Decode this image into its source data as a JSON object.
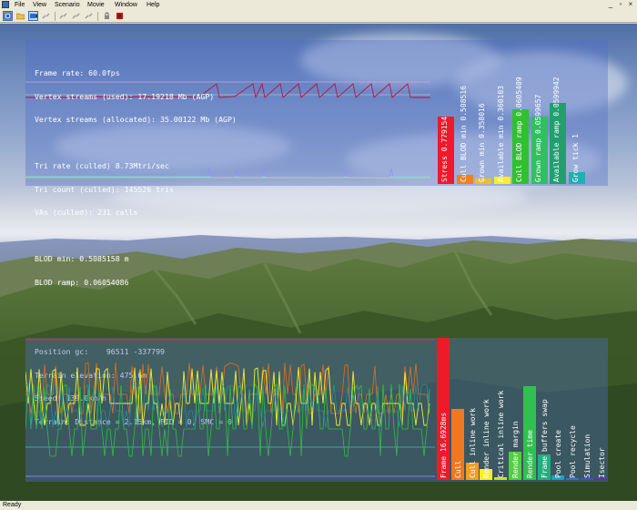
{
  "menubar": {
    "items": [
      "File",
      "View",
      "Scenario",
      "Movie",
      "Window",
      "Help"
    ],
    "window_controls": [
      "_",
      "▫",
      "×"
    ]
  },
  "toolbar": {
    "buttons": [
      {
        "icon": "view-icon",
        "active": true
      },
      {
        "icon": "open-icon",
        "active": false
      },
      {
        "icon": "camera-icon",
        "active": true
      },
      {
        "icon": "link-icon",
        "active": false
      },
      {
        "icon": "link-icon",
        "active": false
      },
      {
        "icon": "link-icon",
        "active": false
      },
      {
        "icon": "link-icon",
        "active": false
      },
      {
        "icon": "lock-icon",
        "active": false
      },
      {
        "icon": "record-icon",
        "active": false
      }
    ]
  },
  "stats": {
    "frame_rate": "Frame rate: 60.0fps",
    "vertex_used": "Vertex streams (used): 17.19218 Mb (AGP)",
    "vertex_alloc": "Vertex streams (allocated): 35.00122 Mb (AGP)",
    "tri_rate": "Tri rate (culled) 8.73Mtri/sec",
    "tri_count": "Tri count (culled): 145526 tris",
    "vas": "VAs (culled): 231 calls",
    "blod_min": "BLOD min: 0.5085158 m",
    "blod_ramp": "BLOD ramp: 0.06054086",
    "position": "Position gc:    96511 -337799",
    "terrain_elev": "Terrain elevation: 475.6m",
    "speed": "Speed: 139.0km/h",
    "terrain_info": "Terrain: Distance = 2.15km, FID = 0, SMC = 0"
  },
  "upper_bars": [
    {
      "label": "Stress 0.779154",
      "color": "#ee1a2a",
      "value": 0.78
    },
    {
      "label": "Cull BLOD min 0.508516",
      "color": "#f08020",
      "value": 0.1
    },
    {
      "label": "Grown min 0.358016",
      "color": "#f0c020",
      "value": 0.06
    },
    {
      "label": "Available min 0.360103",
      "color": "#f8f020",
      "value": 0.08
    },
    {
      "label": "Cull BLOD ramp 0.0605409",
      "color": "#30c030",
      "value": 0.86
    },
    {
      "label": "Grown ramp 0.0599657",
      "color": "#30c060",
      "value": 0.78
    },
    {
      "label": "Available ramp 0.0599942",
      "color": "#20a070",
      "value": 0.94
    },
    {
      "label": "Grow tick 1",
      "color": "#20b0b0",
      "value": 0.14
    }
  ],
  "lower_bars": [
    {
      "label": "Frame 16.6928ms",
      "color": "#ee1a2a",
      "value": 1.0
    },
    {
      "label": "Cull",
      "color": "#f07820",
      "value": 0.5
    },
    {
      "label": "Cull inline work",
      "color": "#f0a020",
      "value": 0.12
    },
    {
      "label": "Render inline work",
      "color": "#f8f020",
      "value": 0.08
    },
    {
      "label": "Critical inline work",
      "color": "#d0e020",
      "value": 0.02
    },
    {
      "label": "Render margin",
      "color": "#50d040",
      "value": 0.2
    },
    {
      "label": "Render time",
      "color": "#30c050",
      "value": 0.66
    },
    {
      "label": "Frame buffers swap",
      "color": "#20b080",
      "value": 0.18
    },
    {
      "label": "Pool create",
      "color": "#20a0c0",
      "value": 0.03
    },
    {
      "label": "Pool recycle",
      "color": "#3070d0",
      "value": 0.01
    },
    {
      "label": "Simulation",
      "color": "#4050c0",
      "value": 0.01
    },
    {
      "label": "Isector",
      "color": "#6030b0",
      "value": 0.01
    }
  ],
  "status": {
    "text": "Ready"
  }
}
